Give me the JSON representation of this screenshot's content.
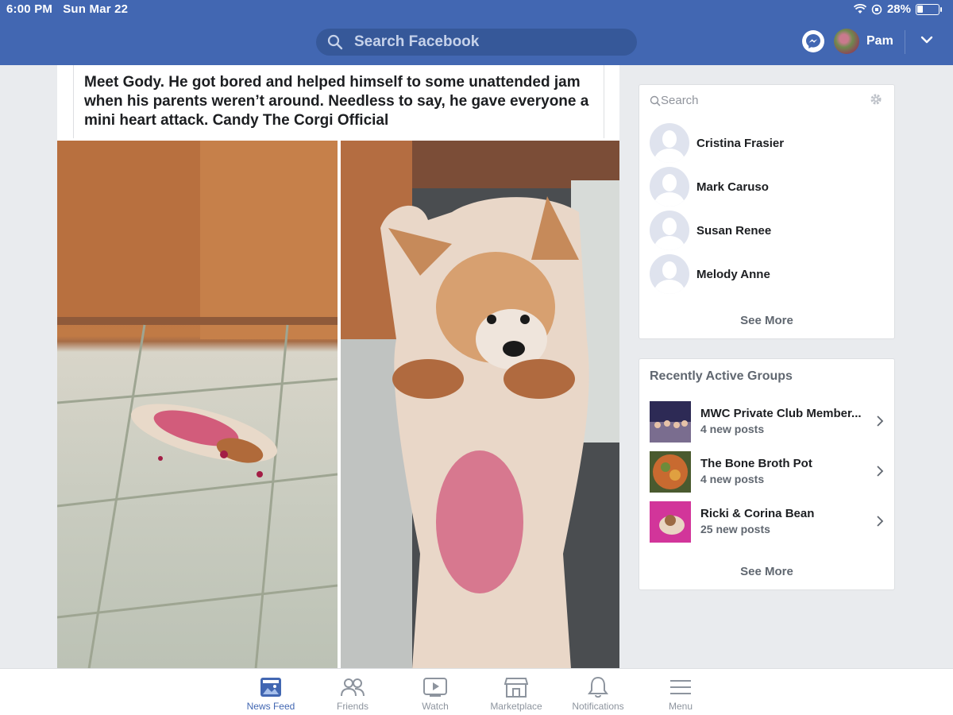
{
  "status_bar": {
    "time": "6:00 PM",
    "date": "Sun Mar 22",
    "battery": "28%"
  },
  "header": {
    "search_placeholder": "Search Facebook",
    "user_name": "Pam",
    "icons": [
      "search-icon",
      "messenger-icon",
      "chevron-down-icon"
    ]
  },
  "post": {
    "text": "Meet Gody. He got bored and helped himself to some unattended jam when his parents weren’t around. Needless to say, he gave everyone a mini heart attack.",
    "mention": "Candy The Corgi Official",
    "photos": [
      "corgi-lying-on-floor-photo",
      "corgi-held-up-photo"
    ]
  },
  "contacts": {
    "search_label": "Search",
    "items": [
      {
        "name": "Cristina Frasier"
      },
      {
        "name": "Mark Caruso"
      },
      {
        "name": "Susan Renee"
      },
      {
        "name": "Melody Anne"
      }
    ],
    "see_more": "See More"
  },
  "groups": {
    "title": "Recently Active Groups",
    "items": [
      {
        "name": "MWC Private Club Member...",
        "posts": "4 new posts"
      },
      {
        "name": "The Bone Broth Pot",
        "posts": "4 new posts"
      },
      {
        "name": "Ricki & Corina Bean",
        "posts": "25 new posts"
      }
    ],
    "see_more": "See More"
  },
  "tabs": [
    {
      "label": "News Feed",
      "icon": "news-feed-icon",
      "active": true
    },
    {
      "label": "Friends",
      "icon": "friends-icon"
    },
    {
      "label": "Watch",
      "icon": "watch-icon"
    },
    {
      "label": "Marketplace",
      "icon": "marketplace-icon"
    },
    {
      "label": "Notifications",
      "icon": "bell-icon"
    },
    {
      "label": "Menu",
      "icon": "menu-icon"
    }
  ],
  "colors": {
    "brand": "#4267b2",
    "background": "#e9ebee"
  }
}
